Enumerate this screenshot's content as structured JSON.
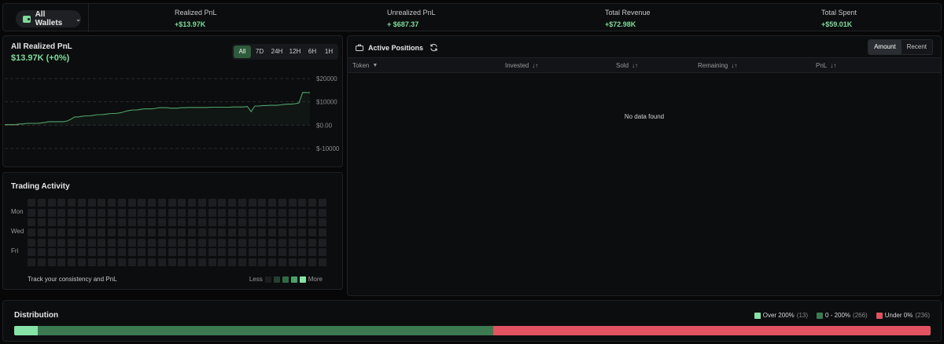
{
  "topbar": {
    "wallet_label": "All Wallets",
    "stats": [
      {
        "label": "Realized PnL",
        "value": "+$13.97K"
      },
      {
        "label": "Unrealized PnL",
        "value": "+ $687.37"
      },
      {
        "label": "Total Revenue",
        "value": "+$72.98K"
      },
      {
        "label": "Total Spent",
        "value": "+$59.01K"
      }
    ]
  },
  "pnl": {
    "title": "All Realized PnL",
    "value": "$13.97K (+0%)",
    "ranges": [
      "All",
      "7D",
      "24H",
      "12H",
      "6H",
      "1H"
    ],
    "active_range": "All",
    "chart_data": {
      "type": "line",
      "y_ticks": [
        "$20000",
        "$10000",
        "$0.00",
        "$-10000"
      ],
      "ylim": [
        -10000,
        20000
      ],
      "values": [
        200,
        200,
        200,
        200,
        500,
        500,
        800,
        800,
        800,
        800,
        1000,
        1200,
        1500,
        1500,
        1500,
        1500,
        1500,
        1800,
        2500,
        3500,
        3500,
        3800,
        4000,
        4000,
        4200,
        4500,
        4500,
        4600,
        4800,
        5000,
        5000,
        5200,
        5500,
        6000,
        6300,
        6500,
        6500,
        6800,
        7000,
        7000,
        7000,
        7200,
        7500,
        7500,
        7500,
        7300,
        7300,
        7300,
        7500,
        7500,
        7600,
        7600,
        7600,
        7600,
        7600,
        7600,
        7700,
        7700,
        7700,
        7700,
        7700,
        7700,
        7800,
        7800,
        7800,
        7800,
        8000,
        5800,
        8200,
        8200,
        8400,
        8400,
        8500,
        8500,
        8500,
        8700,
        8900,
        9000,
        9000,
        9200,
        9500,
        14000,
        14000,
        13970
      ],
      "grid": true,
      "line_color": "#4fa36b"
    }
  },
  "activity": {
    "title": "Trading Activity",
    "day_labels": [
      "Mon",
      "Wed",
      "Fri"
    ],
    "footer": "Track your consistency and PnL",
    "legend_less": "Less",
    "legend_more": "More",
    "legend_colors": [
      "#1c1e21",
      "#23412f",
      "#2f6b45",
      "#4aa26b",
      "#86e3a6"
    ]
  },
  "positions": {
    "title": "Active Positions",
    "sort_tabs": [
      "Amount",
      "Recent"
    ],
    "active_sort": "Amount",
    "columns": [
      "Token",
      "Invested",
      "Sold",
      "Remaining",
      "PnL"
    ],
    "empty_text": "No data found"
  },
  "distribution": {
    "title": "Distribution",
    "buckets": [
      {
        "label": "Over 200%",
        "count": "(13)",
        "color": "#86e3a6",
        "share": 0.026
      },
      {
        "label": "0 - 200%",
        "count": "(266)",
        "color": "#3c7a51",
        "share": 0.497
      },
      {
        "label": "Under 0%",
        "count": "(236)",
        "color": "#e15360",
        "share": 0.477
      }
    ]
  }
}
